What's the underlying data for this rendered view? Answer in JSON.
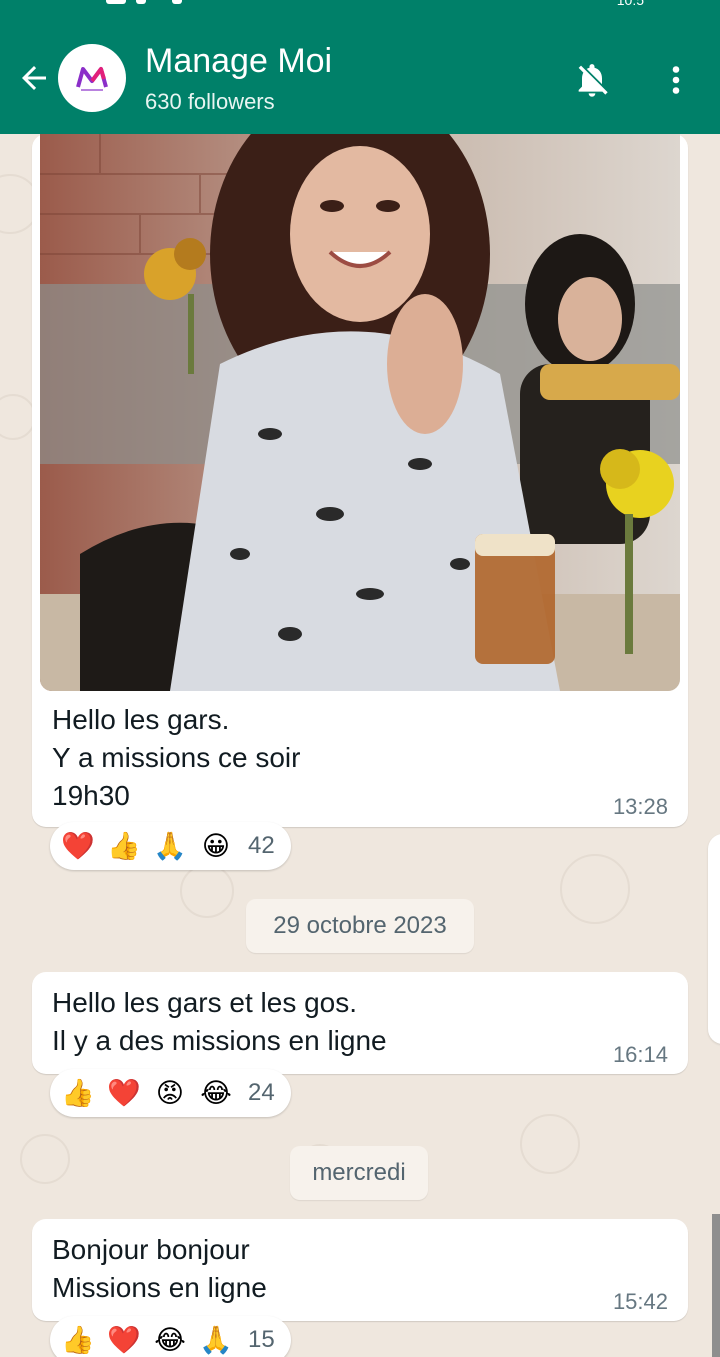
{
  "header": {
    "status_time": "10:5",
    "title": "Manage Moi",
    "subtitle": "630 followers",
    "colors": {
      "header_bg": "#008069",
      "chat_bg": "#efe7de"
    },
    "icons": {
      "back": "arrow-left-icon",
      "mute": "bell-off-icon",
      "menu": "more-vert-icon",
      "avatar": "manage-moi-logo"
    }
  },
  "messages": [
    {
      "has_media": true,
      "media_icon": "gif-image",
      "text": "Hello les gars.\nY a missions ce soir\n19h30",
      "time": "13:28",
      "reactions": {
        "emojis": [
          "❤️",
          "👍",
          "🙏",
          "😀"
        ],
        "count": "42"
      }
    },
    {
      "date_chip": "29 octobre 2023",
      "text": "Hello les gars et les gos.\nIl y a des missions en ligne",
      "time": "16:14",
      "reactions": {
        "emojis": [
          "👍",
          "❤️",
          "😡",
          "😂"
        ],
        "count": "24"
      }
    },
    {
      "date_chip": "mercredi",
      "text": "Bonjour bonjour\nMissions en ligne",
      "time": "15:42",
      "reactions": {
        "emojis": [
          "👍",
          "❤️",
          "😂",
          "🙏"
        ],
        "count": "15"
      }
    }
  ]
}
